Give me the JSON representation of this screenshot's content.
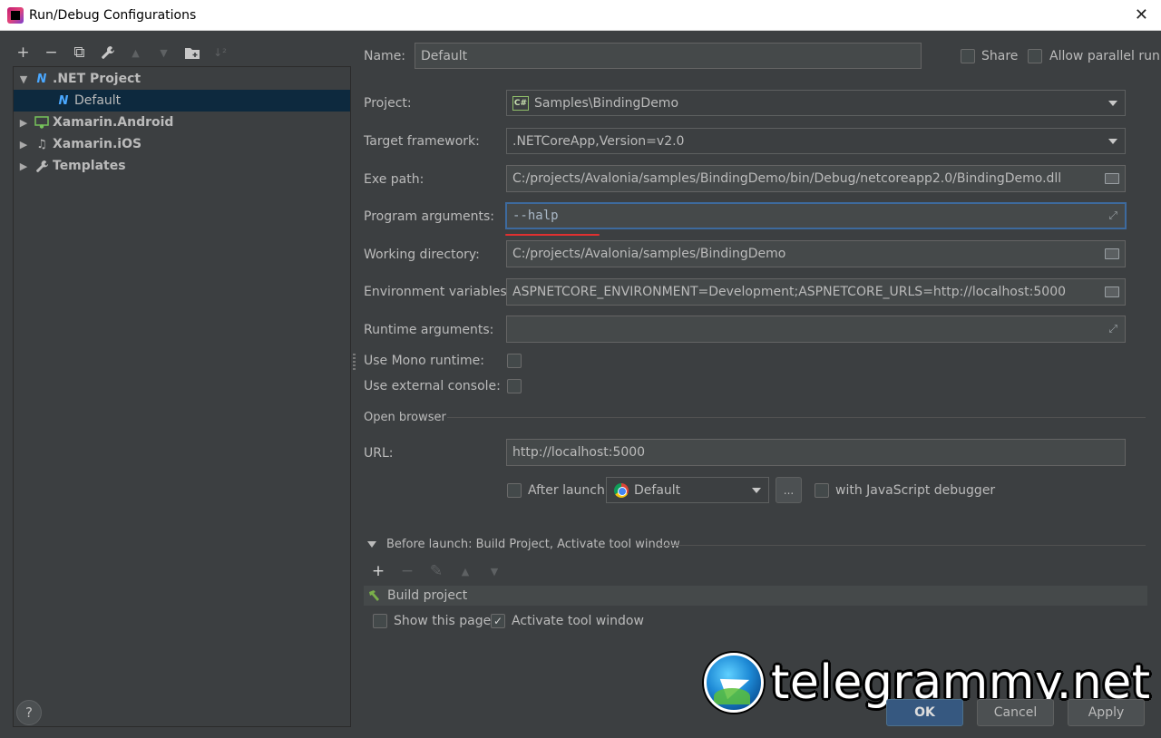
{
  "window": {
    "title": "Run/Debug Configurations",
    "close_glyph": "✕"
  },
  "left_toolbar": {
    "add": "+",
    "remove": "−",
    "copy": "⧉",
    "edit": "🔧",
    "up": "▲",
    "down": "▼",
    "folder": "📁",
    "sort": "↓²"
  },
  "tree": {
    "items": [
      {
        "label": ".NET Project",
        "icon": "dotnet-icon",
        "expanded": true
      },
      {
        "label": "Default",
        "icon": "dotnet-icon",
        "selected": true
      },
      {
        "label": "Xamarin.Android",
        "icon": "android-icon"
      },
      {
        "label": "Xamarin.iOS",
        "icon": "ios-icon"
      },
      {
        "label": "Templates",
        "icon": "wrench-icon"
      }
    ]
  },
  "header": {
    "name_label": "Name:",
    "name_value": "Default",
    "share_label": "Share",
    "allow_parallel_label": "Allow parallel run"
  },
  "form": {
    "project_label": "Project:",
    "project_value": "Samples\\BindingDemo",
    "project_icon_text": "C#",
    "target_framework_label": "Target framework:",
    "target_framework_value": ".NETCoreApp,Version=v2.0",
    "exe_path_label": "Exe path:",
    "exe_path_value": "C:/projects/Avalonia/samples/BindingDemo/bin/Debug/netcoreapp2.0/BindingDemo.dll",
    "program_args_label": "Program arguments:",
    "program_args_value": "--halp",
    "working_dir_label": "Working directory:",
    "working_dir_value": "C:/projects/Avalonia/samples/BindingDemo",
    "env_vars_label": "Environment variables:",
    "env_vars_value": "ASPNETCORE_ENVIRONMENT=Development;ASPNETCORE_URLS=http://localhost:5000",
    "runtime_args_label": "Runtime arguments:",
    "runtime_args_value": "",
    "use_mono_label": "Use Mono runtime:",
    "use_external_console_label": "Use external console:"
  },
  "open_browser": {
    "section_label": "Open browser",
    "url_label": "URL:",
    "url_value": "http://localhost:5000",
    "after_launch_label": "After launch",
    "browser_value": "Default",
    "ellipsis": "...",
    "js_debugger_label": "with JavaScript debugger"
  },
  "before_launch": {
    "section_label": "Before launch: Build Project, Activate tool window",
    "add": "+",
    "remove": "−",
    "edit": "✎",
    "up": "▲",
    "down": "▼",
    "tasks": [
      {
        "label": "Build project"
      }
    ],
    "show_page_label": "Show this page",
    "activate_tool_label": "Activate tool window",
    "activate_check": "✓"
  },
  "buttons": {
    "help": "?",
    "ok": "OK",
    "cancel": "Cancel",
    "apply": "Apply"
  },
  "watermark": {
    "text": "telegrammy.net"
  },
  "colors": {
    "background": "#3c3f41",
    "selection": "#0d293e",
    "primary_button": "#365880",
    "focus_border": "#3d6a9e",
    "error_underline": "#e03030"
  }
}
